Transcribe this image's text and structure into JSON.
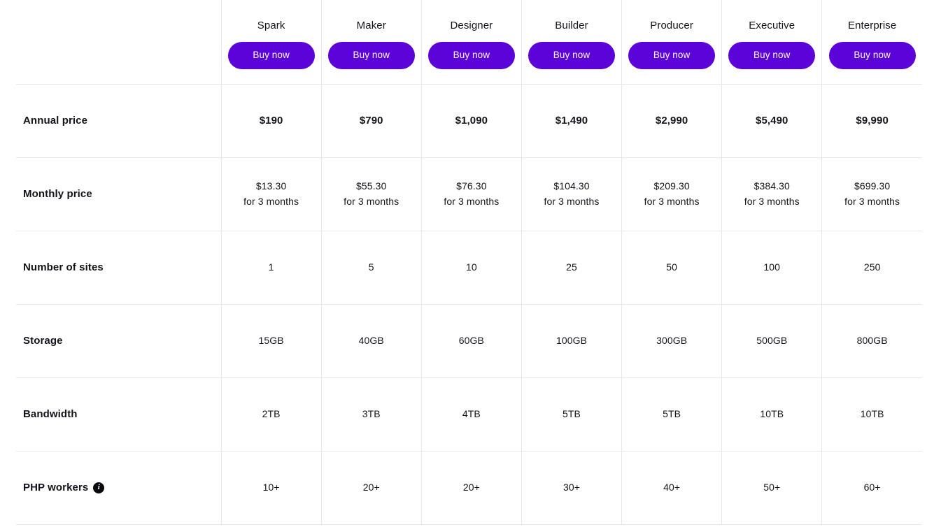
{
  "table": {
    "feature_column_header": "",
    "plans": [
      {
        "name": "Spark",
        "cta": "Buy now"
      },
      {
        "name": "Maker",
        "cta": "Buy now"
      },
      {
        "name": "Designer",
        "cta": "Buy now"
      },
      {
        "name": "Builder",
        "cta": "Buy now"
      },
      {
        "name": "Producer",
        "cta": "Buy now"
      },
      {
        "name": "Executive",
        "cta": "Buy now"
      },
      {
        "name": "Enterprise",
        "cta": "Buy now"
      }
    ],
    "rows": [
      {
        "label": "Annual price",
        "has_info_icon": false,
        "bold_values": true,
        "values": [
          "$190",
          "$790",
          "$1,090",
          "$1,490",
          "$2,990",
          "$5,490",
          "$9,990"
        ],
        "subnotes": [
          "",
          "",
          "",
          "",
          "",
          "",
          ""
        ]
      },
      {
        "label": "Monthly price",
        "has_info_icon": false,
        "bold_values": false,
        "values": [
          "$13.30",
          "$55.30",
          "$76.30",
          "$104.30",
          "$209.30",
          "$384.30",
          "$699.30"
        ],
        "subnotes": [
          "for 3 months",
          "for 3 months",
          "for 3 months",
          "for 3 months",
          "for 3 months",
          "for 3 months",
          "for 3 months"
        ]
      },
      {
        "label": "Number of sites",
        "has_info_icon": false,
        "bold_values": false,
        "values": [
          "1",
          "5",
          "10",
          "25",
          "50",
          "100",
          "250"
        ],
        "subnotes": [
          "",
          "",
          "",
          "",
          "",
          "",
          ""
        ]
      },
      {
        "label": "Storage",
        "has_info_icon": false,
        "bold_values": false,
        "values": [
          "15GB",
          "40GB",
          "60GB",
          "100GB",
          "300GB",
          "500GB",
          "800GB"
        ],
        "subnotes": [
          "",
          "",
          "",
          "",
          "",
          "",
          ""
        ]
      },
      {
        "label": "Bandwidth",
        "has_info_icon": false,
        "bold_values": false,
        "values": [
          "2TB",
          "3TB",
          "4TB",
          "5TB",
          "5TB",
          "10TB",
          "10TB"
        ],
        "subnotes": [
          "",
          "",
          "",
          "",
          "",
          "",
          ""
        ]
      },
      {
        "label": "PHP workers",
        "has_info_icon": true,
        "info_icon_name": "info-icon",
        "bold_values": false,
        "values": [
          "10+",
          "20+",
          "20+",
          "30+",
          "40+",
          "50+",
          "60+"
        ],
        "subnotes": [
          "",
          "",
          "",
          "",
          "",
          "",
          ""
        ]
      }
    ]
  },
  "colors": {
    "accent": "#5b03d8",
    "text": "#15131a",
    "border": "#e8e8ea",
    "background": "#ffffff",
    "info_icon_bg": "#0b0b0f"
  }
}
